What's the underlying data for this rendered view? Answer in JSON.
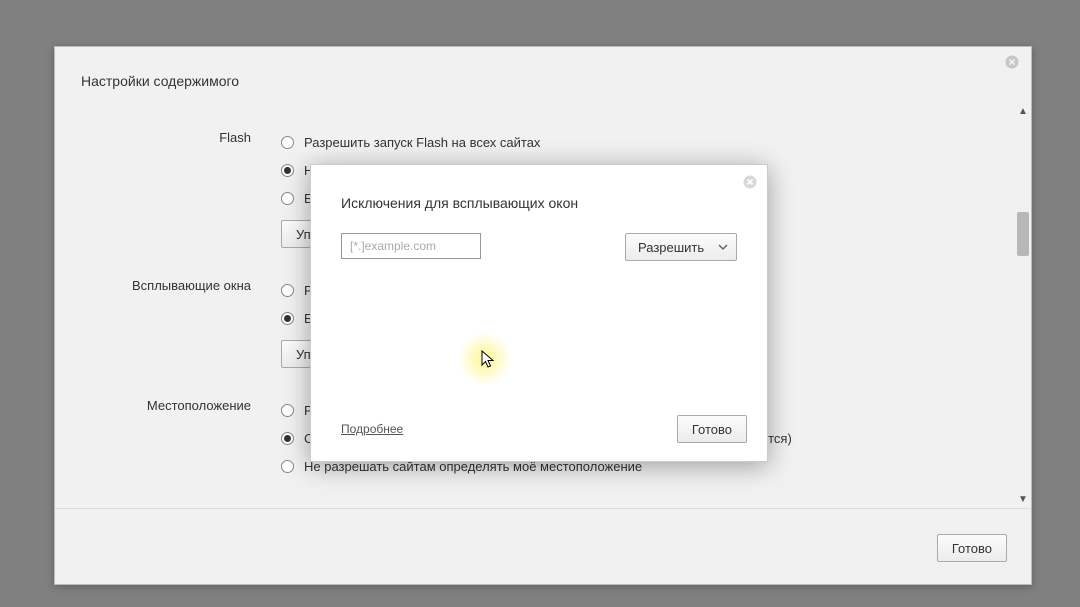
{
  "outer": {
    "title": "Настройки содержимого",
    "done_label": "Готово"
  },
  "flash": {
    "label": "Flash",
    "opt_allow": "Разрешить запуск Flash на всех сайтах",
    "opt_detect": "Находить и запускать только важный контент (рекомендуется)",
    "opt_block": "Блокировать Flash на всех сайтах",
    "manage_label": "Управление исключениями..."
  },
  "popups": {
    "label": "Всплывающие окна",
    "opt_allow": "Разрешить всплывающие окна на всех сайтах",
    "opt_block": "Блокировать всплывающие окна на всех сайтах (рекомендуется)",
    "manage_label": "Управление исключениями..."
  },
  "location": {
    "label": "Местоположение",
    "opt_allow": "Разрешить всем сайтам определять моё местоположение",
    "opt_ask": "Спрашивать, если сайт хочет определить моё местоположение (рекомендуется)",
    "opt_block": "Не разрешать сайтам определять моё местоположение"
  },
  "modal": {
    "title": "Исключения для всплывающих окон",
    "placeholder": "[*.]example.com",
    "select_value": "Разрешить",
    "learn_more": "Подробнее",
    "done_label": "Готово"
  }
}
